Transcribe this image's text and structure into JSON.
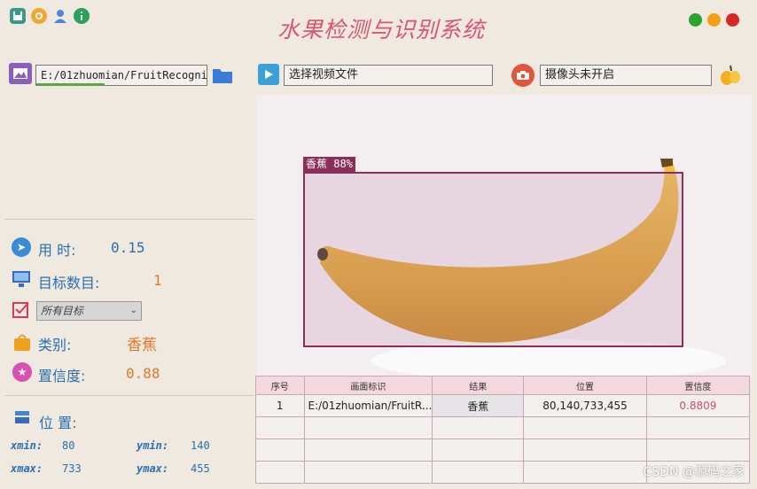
{
  "app": {
    "title": "水果检测与识别系统",
    "window_controls": {
      "green": "#2aa52a",
      "orange": "#f0a010",
      "red": "#d92626"
    }
  },
  "topbar_icons": [
    "save-icon",
    "settings-icon",
    "user-icon",
    "info-icon"
  ],
  "toolbar": {
    "image_path": "E:/01zhuomian/FruitRecognit",
    "image_progress": 0.55,
    "video_placeholder": "选择视频文件",
    "camera_status": "摄像头未开启"
  },
  "stats": {
    "time_label": "用  时:",
    "time_value": "0.15",
    "count_label": "目标数目:",
    "count_value": "1",
    "target_select": "所有目标",
    "class_label": "类别:",
    "class_value": "香蕉",
    "conf_label": "置信度:",
    "conf_value": "0.88",
    "pos_label": "位  置:",
    "xmin_k": "xmin:",
    "xmin_v": "80",
    "ymin_k": "ymin:",
    "ymin_v": "140",
    "xmax_k": "xmax:",
    "xmax_v": "733",
    "ymax_k": "ymax:",
    "ymax_v": "455"
  },
  "detection": {
    "label": "香蕉 88%"
  },
  "table": {
    "headers": [
      "序号",
      "画面标识",
      "结果",
      "位置",
      "置信度"
    ],
    "rows": [
      [
        "1",
        "E:/01zhuomian/FruitR...",
        "香蕉",
        "80,140,733,455",
        "0.8809"
      ]
    ]
  },
  "watermark": "CSDN @源码之家"
}
